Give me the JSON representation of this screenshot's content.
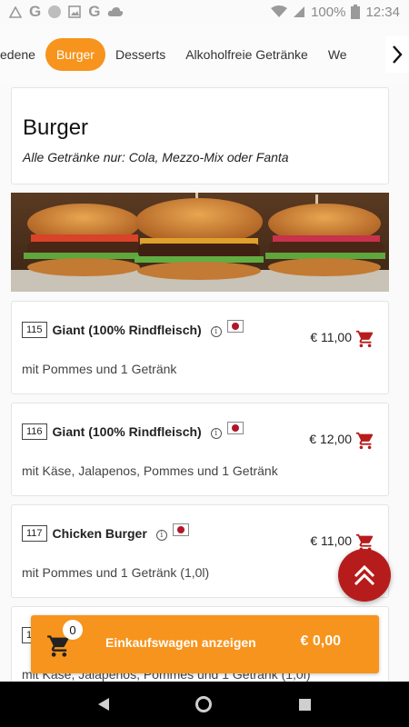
{
  "statusbar": {
    "battery": "100%",
    "time": "12:34",
    "g1": "G",
    "g2": "G"
  },
  "tabs": {
    "items": [
      "edene",
      "Burger",
      "Desserts",
      "Alkoholfreie Getränke",
      "We"
    ],
    "active": "Burger",
    "next_icon": "chevron-right-icon"
  },
  "section": {
    "title": "Burger",
    "subtitle": "Alle Getränke nur: Cola, Mezzo-Mix oder Fanta"
  },
  "items": [
    {
      "number": "115",
      "name": "Giant (100% Rindfleisch)",
      "price": "€ 11,00",
      "description": "mit Pommes und 1 Getränk"
    },
    {
      "number": "116",
      "name": "Giant (100% Rindfleisch)",
      "price": "€ 12,00",
      "description": "mit Käse, Jalapenos, Pommes und 1 Getränk"
    },
    {
      "number": "117",
      "name": "Chicken Burger",
      "price": "€ 11,00",
      "description": "mit Pommes und 1 Getränk (1,0l)"
    },
    {
      "number": "1",
      "name": "",
      "price": "",
      "description": "mit Käse, Jalapenos, Pommes und 1 Getränk (1,0l)"
    }
  ],
  "cart": {
    "count": "0",
    "label": "Einkaufswagen anzeigen",
    "total": "€ 0,00"
  },
  "colors": {
    "accent": "#f7941d",
    "cart_icon": "#b71c1c",
    "scroll_top": "#b71c1c"
  }
}
